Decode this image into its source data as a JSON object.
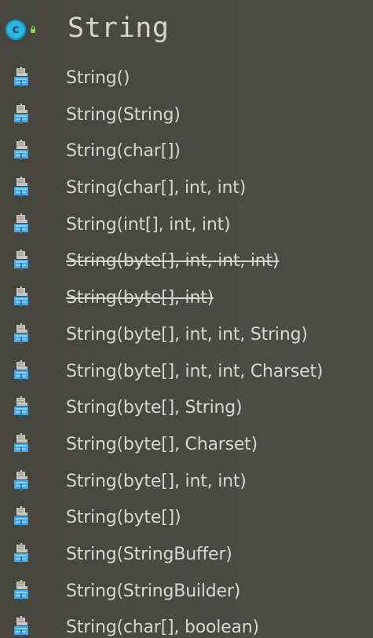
{
  "header": {
    "class_letter": "c",
    "title": "String",
    "class_icon": "class-c-icon",
    "access_icon": "lock-icon"
  },
  "constructors": [
    {
      "label": "String()",
      "deprecated": false
    },
    {
      "label": "String(String)",
      "deprecated": false
    },
    {
      "label": "String(char[])",
      "deprecated": false
    },
    {
      "label": "String(char[], int, int)",
      "deprecated": false
    },
    {
      "label": "String(int[], int, int)",
      "deprecated": false
    },
    {
      "label": "String(byte[], int, int, int)",
      "deprecated": true
    },
    {
      "label": "String(byte[], int)",
      "deprecated": true
    },
    {
      "label": "String(byte[], int, int, String)",
      "deprecated": false
    },
    {
      "label": "String(byte[], int, int, Charset)",
      "deprecated": false
    },
    {
      "label": "String(byte[], String)",
      "deprecated": false
    },
    {
      "label": "String(byte[], Charset)",
      "deprecated": false
    },
    {
      "label": "String(byte[], int, int)",
      "deprecated": false
    },
    {
      "label": "String(byte[])",
      "deprecated": false
    },
    {
      "label": "String(StringBuffer)",
      "deprecated": false
    },
    {
      "label": "String(StringBuilder)",
      "deprecated": false
    },
    {
      "label": "String(char[], boolean)",
      "deprecated": false
    }
  ],
  "colors": {
    "background": "#4a4a44",
    "text": "#d8d6d1",
    "icon_blue": "#49a7df",
    "icon_gray": "#cbc8c2",
    "badge_blue": "#2bb8e0",
    "lock_green": "#8fd14f"
  },
  "icons": {
    "constructor": "constructor-icon"
  }
}
